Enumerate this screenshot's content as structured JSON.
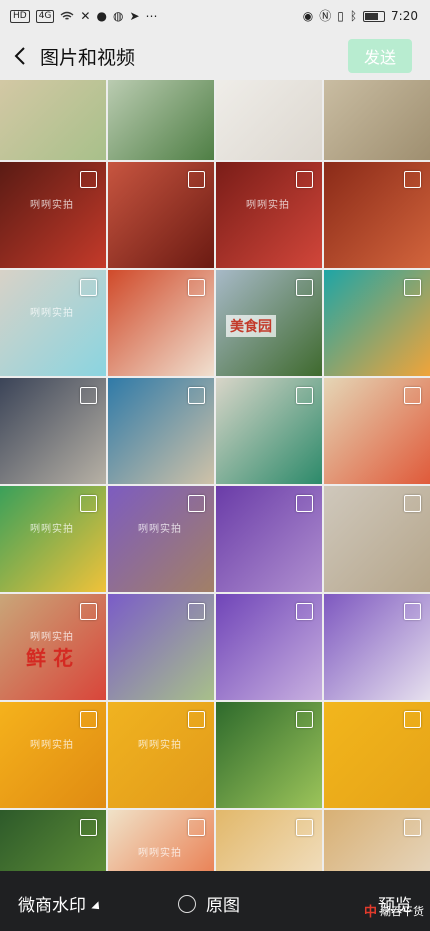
{
  "status_bar": {
    "left_badges": [
      "HD",
      "4G"
    ],
    "time": "7:20"
  },
  "header": {
    "title": "图片和视频",
    "send_label": "发送"
  },
  "photos": [
    {
      "desc": "box"
    },
    {
      "desc": "bowl"
    },
    {
      "desc": "white pot"
    },
    {
      "desc": "grains"
    },
    {
      "desc": "jar"
    },
    {
      "desc": "chili"
    },
    {
      "desc": "jar"
    },
    {
      "desc": "chili sauce"
    },
    {
      "desc": "jar and heart"
    },
    {
      "desc": "sauce bowl"
    },
    {
      "desc": "rice bag"
    },
    {
      "desc": "blocks table"
    },
    {
      "desc": "child"
    },
    {
      "desc": "child table"
    },
    {
      "desc": "board"
    },
    {
      "desc": "blocks"
    },
    {
      "desc": "blocks"
    },
    {
      "desc": "flowers vase"
    },
    {
      "desc": "flowers"
    },
    {
      "desc": "box"
    },
    {
      "desc": "box"
    },
    {
      "desc": "flowers pot"
    },
    {
      "desc": "flowers"
    },
    {
      "desc": "flowers"
    },
    {
      "desc": "mango"
    },
    {
      "desc": "mango"
    },
    {
      "desc": "green mango"
    },
    {
      "desc": "mango"
    },
    {
      "desc": "green mango"
    },
    {
      "desc": "crackers"
    },
    {
      "desc": "crackers"
    },
    {
      "desc": "cracker"
    }
  ],
  "watermark_text": "咧咧实拍",
  "box_text": "鲜 花",
  "rice_bag_text": "美食园",
  "bottom_bar": {
    "watermark_label": "微商水印",
    "original_label": "原图",
    "preview_label": "预览",
    "brand_red": "中",
    "brand_text": "潮吞干货"
  },
  "colors": {
    "send_button": "#b8ecd0",
    "bottom_bar": "#1f2022"
  }
}
